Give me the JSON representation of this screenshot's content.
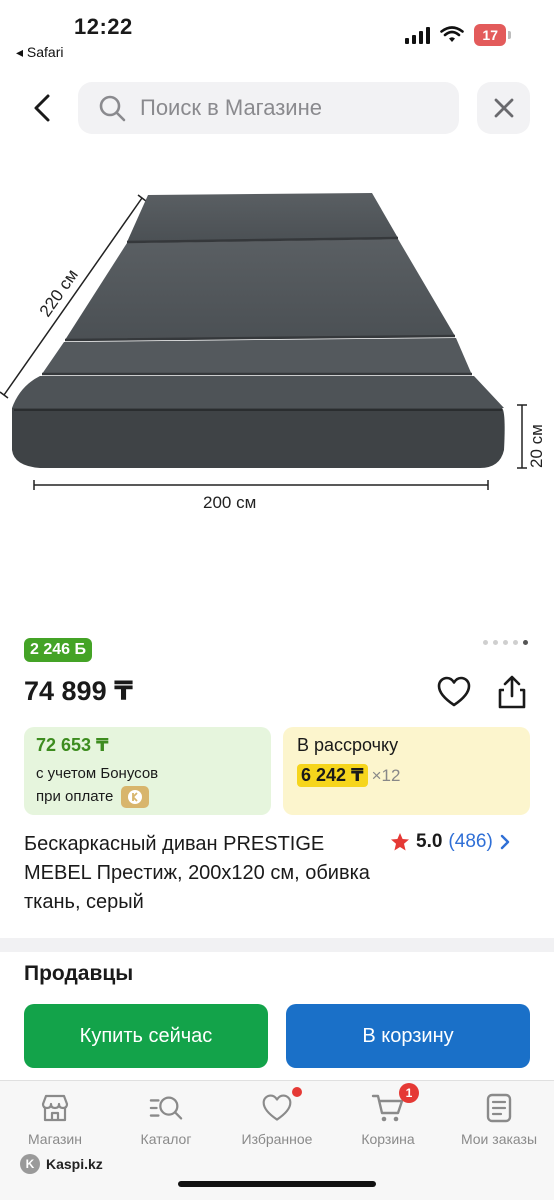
{
  "status": {
    "time": "12:22",
    "back_app": "◂ Safari",
    "battery": "17"
  },
  "search": {
    "placeholder": "Поиск в Магазине"
  },
  "product_image": {
    "width_label": "200 см",
    "length_label": "220 см",
    "height_label": "20 см",
    "slide_count": 5,
    "active_slide": 5
  },
  "bonus_badge": "2 246 Б",
  "price": "74 899 ₸",
  "bonus_offer": {
    "amount": "72 653 ₸",
    "line1": "с учетом Бонусов",
    "line2": "при оплате"
  },
  "installment": {
    "label": "В рассрочку",
    "monthly": "6 242 ₸",
    "months": "×12"
  },
  "title": "Бескаркасный диван PRESTIGE MEBEL Престиж, 200х120 см, обивка ткань, серый",
  "rating": {
    "score": "5.0",
    "count": "(486)"
  },
  "sellers_heading": "Продавцы",
  "actions": {
    "buy_now": "Купить сейчас",
    "add_to_cart": "В корзину"
  },
  "tabbar": {
    "items": [
      {
        "label": "Магазин",
        "icon": "store-icon"
      },
      {
        "label": "Каталог",
        "icon": "catalog-search-icon"
      },
      {
        "label": "Избранное",
        "icon": "heart-icon"
      },
      {
        "label": "Корзина",
        "icon": "cart-icon",
        "badge": "1"
      },
      {
        "label": "Мои заказы",
        "icon": "orders-icon"
      }
    ]
  },
  "footer": {
    "domain": "Kaspi.kz"
  },
  "colors": {
    "green": "#13a34a",
    "blue": "#1a70c8",
    "bonus_green": "#44a326",
    "highlight_yellow": "#f6d51c",
    "red": "#e53935"
  }
}
